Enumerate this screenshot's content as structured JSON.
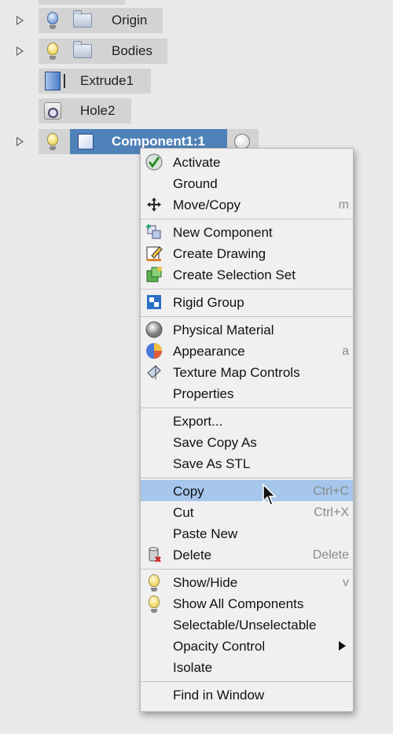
{
  "tree": {
    "origin_label": "Origin",
    "bodies_label": "Bodies",
    "extrude_label": "Extrude1",
    "hole_label": "Hole2",
    "component_label": "Component1:1"
  },
  "menu": {
    "activate": "Activate",
    "ground": "Ground",
    "move_copy": "Move/Copy",
    "move_copy_shortcut": "m",
    "new_component": "New Component",
    "create_drawing": "Create Drawing",
    "create_selection_set": "Create Selection Set",
    "rigid_group": "Rigid Group",
    "physical_material": "Physical Material",
    "appearance": "Appearance",
    "appearance_shortcut": "a",
    "texture_map_controls": "Texture Map Controls",
    "properties": "Properties",
    "export": "Export...",
    "save_copy_as": "Save Copy As",
    "save_as_stl": "Save As STL",
    "copy": "Copy",
    "copy_shortcut": "Ctrl+C",
    "cut": "Cut",
    "cut_shortcut": "Ctrl+X",
    "paste_new": "Paste New",
    "delete": "Delete",
    "delete_shortcut": "Delete",
    "show_hide": "Show/Hide",
    "show_hide_shortcut": "v",
    "show_all_components": "Show All Components",
    "selectable_unselectable": "Selectable/Unselectable",
    "opacity_control": "Opacity Control",
    "isolate": "Isolate",
    "find_in_window": "Find in Window"
  },
  "colors": {
    "highlight": "#a6c6ec",
    "selected_node": "#4f82b8",
    "panel_bg": "#e9e9e9"
  }
}
